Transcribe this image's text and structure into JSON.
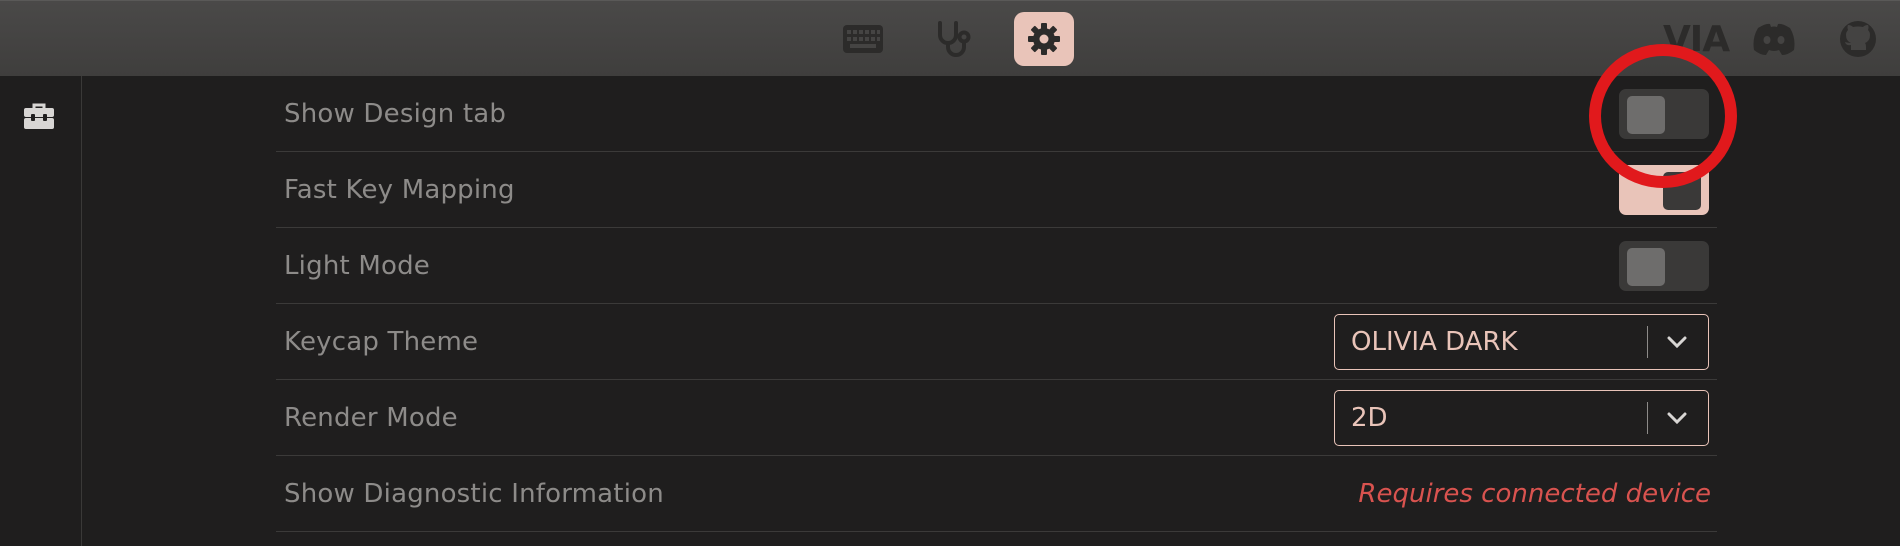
{
  "topbar": {
    "tabs": [
      {
        "icon": "keyboard-icon",
        "active": false
      },
      {
        "icon": "stethoscope-icon",
        "active": false
      },
      {
        "icon": "gear-icon",
        "active": true
      }
    ],
    "right": {
      "logo_text": "VIA",
      "discord_icon": "discord-icon",
      "github_icon": "github-icon"
    }
  },
  "sidebar": {
    "items": [
      {
        "icon": "toolbox-icon"
      }
    ]
  },
  "settings": {
    "show_design_tab": {
      "label": "Show Design tab",
      "enabled": false
    },
    "fast_key_mapping": {
      "label": "Fast Key Mapping",
      "enabled": true
    },
    "light_mode": {
      "label": "Light Mode",
      "enabled": false
    },
    "keycap_theme": {
      "label": "Keycap Theme",
      "value": "OLIVIA DARK"
    },
    "render_mode": {
      "label": "Render Mode",
      "value": "2D"
    },
    "show_diagnostic": {
      "label": "Show Diagnostic Information",
      "note": "Requires connected device"
    }
  },
  "colors": {
    "accent": "#e9c4b9",
    "background": "#1f1e1e",
    "topbar": "#444342",
    "label": "#8d8b89",
    "warning": "#d9534f",
    "annotation": "#e1191c"
  }
}
